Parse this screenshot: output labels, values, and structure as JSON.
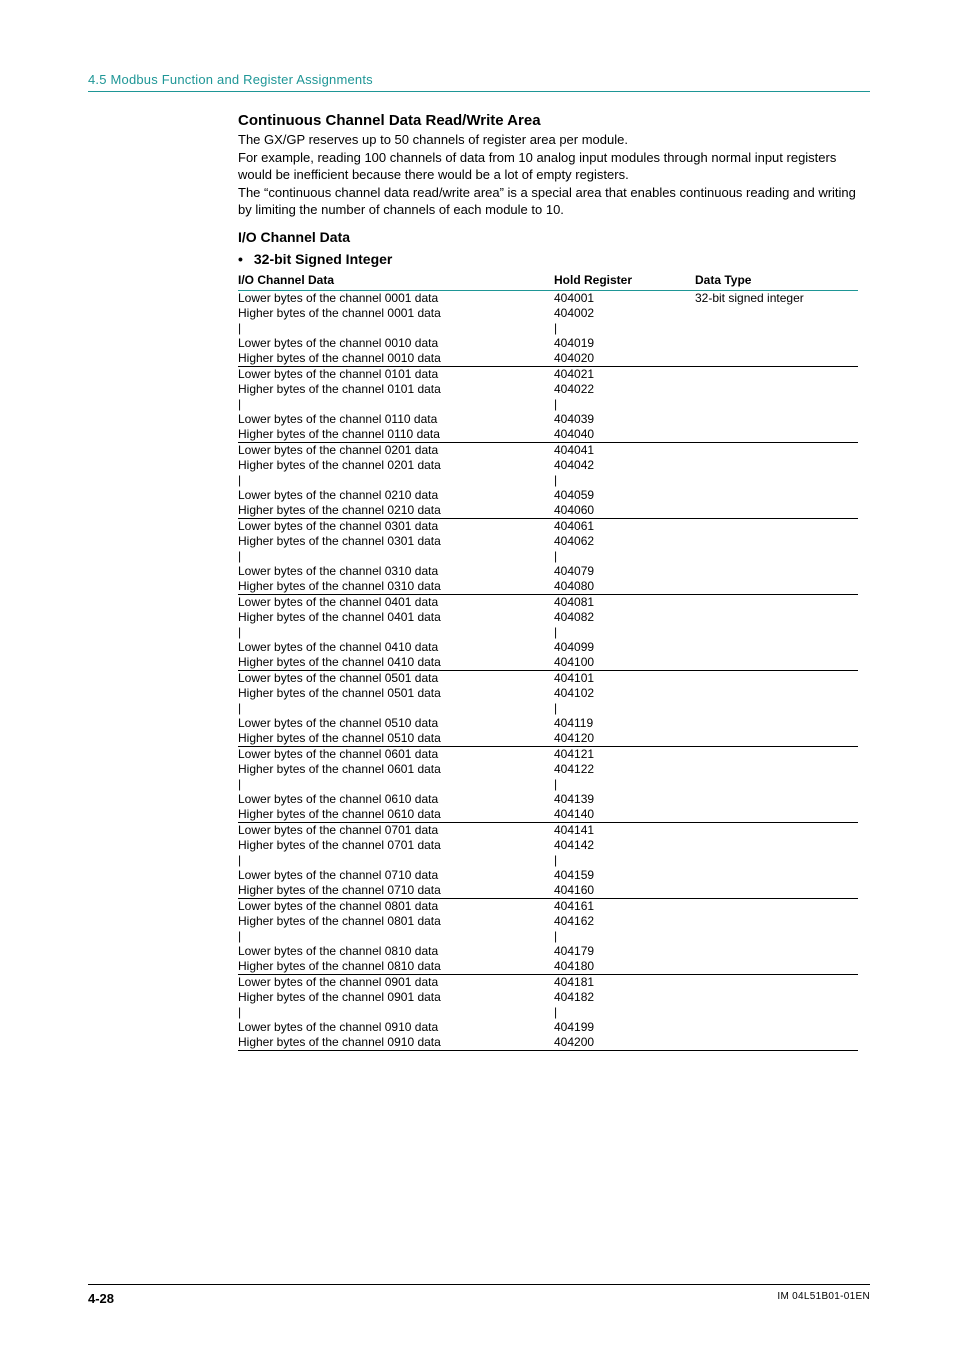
{
  "header": {
    "section": "4.5  Modbus Function and Register Assignments"
  },
  "titles": {
    "h3": "Continuous Channel Data Read/Write Area",
    "p1": "The GX/GP reserves up to 50 channels of register area per module.",
    "p2": "For example, reading 100 channels of data from 10 analog input modules through normal input registers would be inefficient because there would be a lot of empty registers.",
    "p3": "The “continuous channel data read/write area” is a special area that enables continuous reading and writing by limiting the number of channels of each module to 10.",
    "h4": "I/O Channel Data",
    "bullet": "32-bit Signed Integer"
  },
  "table": {
    "headers": [
      "I/O Channel Data",
      "Hold Register",
      "Data Type"
    ],
    "data_type": "32-bit signed integer",
    "groups": [
      {
        "ch_lo": "0001",
        "ch_hi": "0010",
        "r0": "404001",
        "r1": "404002",
        "r2": "404019",
        "r3": "404020"
      },
      {
        "ch_lo": "0101",
        "ch_hi": "0110",
        "r0": "404021",
        "r1": "404022",
        "r2": "404039",
        "r3": "404040"
      },
      {
        "ch_lo": "0201",
        "ch_hi": "0210",
        "r0": "404041",
        "r1": "404042",
        "r2": "404059",
        "r3": "404060"
      },
      {
        "ch_lo": "0301",
        "ch_hi": "0310",
        "r0": "404061",
        "r1": "404062",
        "r2": "404079",
        "r3": "404080"
      },
      {
        "ch_lo": "0401",
        "ch_hi": "0410",
        "r0": "404081",
        "r1": "404082",
        "r2": "404099",
        "r3": "404100"
      },
      {
        "ch_lo": "0501",
        "ch_hi": "0510",
        "r0": "404101",
        "r1": "404102",
        "r2": "404119",
        "r3": "404120"
      },
      {
        "ch_lo": "0601",
        "ch_hi": "0610",
        "r0": "404121",
        "r1": "404122",
        "r2": "404139",
        "r3": "404140"
      },
      {
        "ch_lo": "0701",
        "ch_hi": "0710",
        "r0": "404141",
        "r1": "404142",
        "r2": "404159",
        "r3": "404160"
      },
      {
        "ch_lo": "0801",
        "ch_hi": "0810",
        "r0": "404161",
        "r1": "404162",
        "r2": "404179",
        "r3": "404180"
      },
      {
        "ch_lo": "0901",
        "ch_hi": "0910",
        "r0": "404181",
        "r1": "404182",
        "r2": "404199",
        "r3": "404200"
      }
    ],
    "row_labels": {
      "lower": "Lower bytes of the channel {CH} data",
      "higher": "Higher bytes of the channel {CH} data"
    },
    "ellipsis": "|"
  },
  "footer": {
    "page": "4-28",
    "doc": "IM 04L51B01-01EN"
  }
}
